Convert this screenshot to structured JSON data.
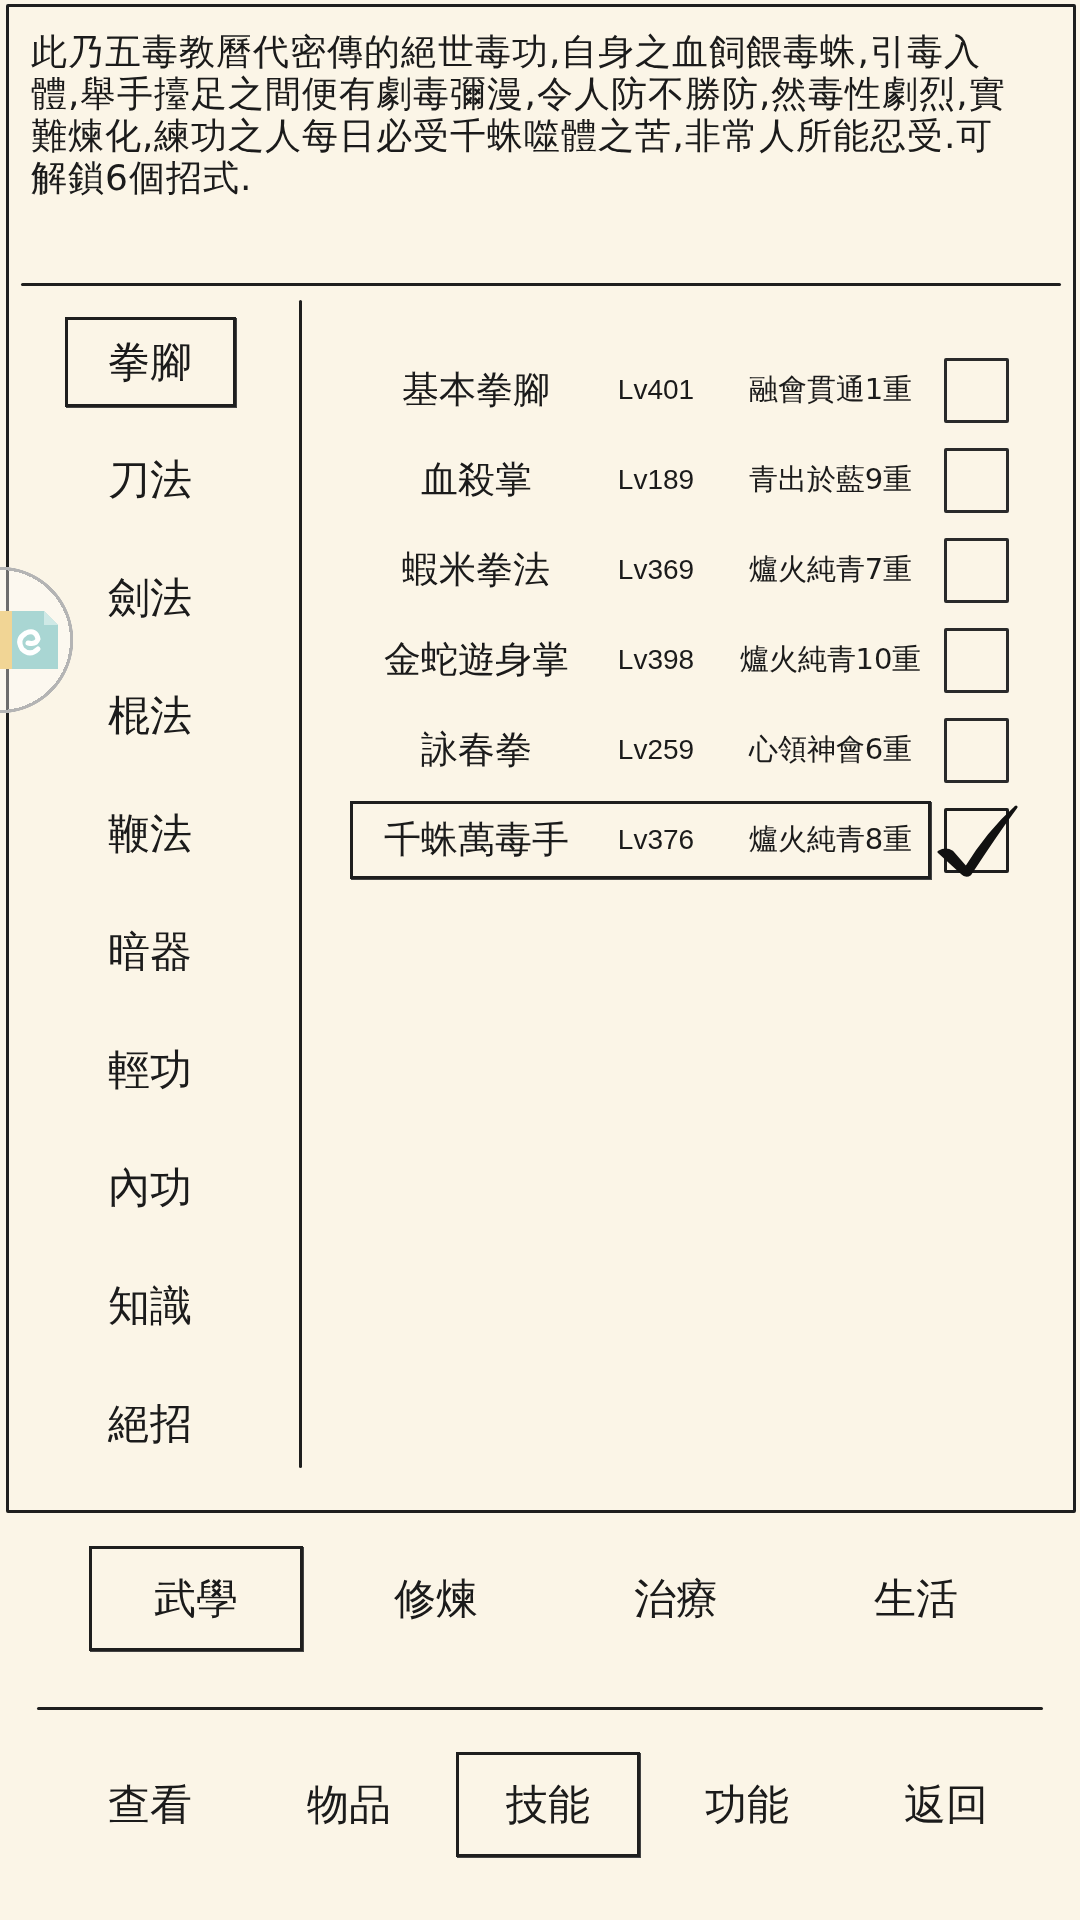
{
  "description": "此乃五毒教曆代密傳的絕世毒功,自身之血飼餵毒蛛,引毒入體,舉手擡足之間便有劇毒彌漫,令人防不勝防,然毒性劇烈,實難煉化,練功之人每日必受千蛛噬體之苦,非常人所能忍受.可解鎖6個招式.",
  "categories": [
    {
      "label": "拳腳",
      "selected": true
    },
    {
      "label": "刀法",
      "selected": false
    },
    {
      "label": "劍法",
      "selected": false
    },
    {
      "label": "棍法",
      "selected": false
    },
    {
      "label": "鞭法",
      "selected": false
    },
    {
      "label": "暗器",
      "selected": false
    },
    {
      "label": "輕功",
      "selected": false
    },
    {
      "label": "內功",
      "selected": false
    },
    {
      "label": "知識",
      "selected": false
    },
    {
      "label": "絕招",
      "selected": false
    }
  ],
  "skills": [
    {
      "name": "基本拳腳",
      "lv": "Lv401",
      "rank": "融會貫通1重",
      "selected": false,
      "checked": false
    },
    {
      "name": "血殺掌",
      "lv": "Lv189",
      "rank": "青出於藍9重",
      "selected": false,
      "checked": false
    },
    {
      "name": "蝦米拳法",
      "lv": "Lv369",
      "rank": "爐火純青7重",
      "selected": false,
      "checked": false
    },
    {
      "name": "金蛇遊身掌",
      "lv": "Lv398",
      "rank": "爐火純青10重",
      "selected": false,
      "checked": false
    },
    {
      "name": "詠春拳",
      "lv": "Lv259",
      "rank": "心領神會6重",
      "selected": false,
      "checked": false
    },
    {
      "name": "千蛛萬毒手",
      "lv": "Lv376",
      "rank": "爐火純青8重",
      "selected": true,
      "checked": true
    }
  ],
  "section_tabs": [
    {
      "label": "武學",
      "selected": true
    },
    {
      "label": "修煉",
      "selected": false
    },
    {
      "label": "治療",
      "selected": false
    },
    {
      "label": "生活",
      "selected": false
    }
  ],
  "nav_tabs": [
    {
      "label": "查看",
      "selected": false
    },
    {
      "label": "物品",
      "selected": false
    },
    {
      "label": "技能",
      "selected": true
    },
    {
      "label": "功能",
      "selected": false
    },
    {
      "label": "返回",
      "selected": false
    }
  ]
}
